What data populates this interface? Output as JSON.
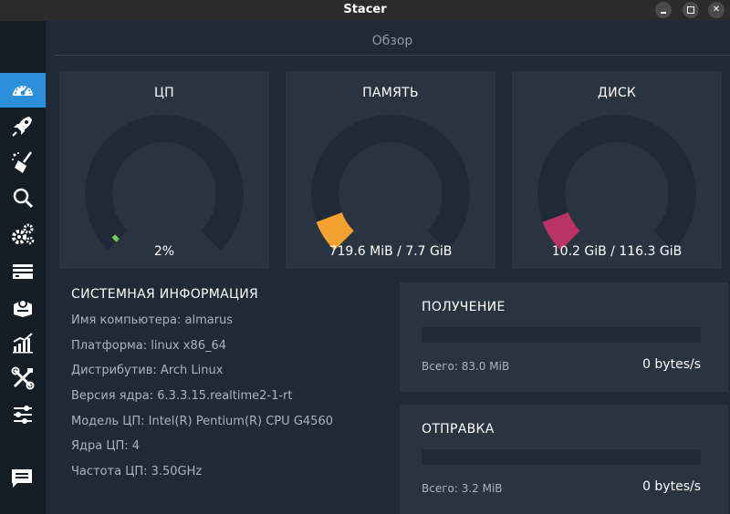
{
  "window": {
    "title": "Stacer"
  },
  "sidebar": {
    "items": [
      {
        "name": "dashboard",
        "icon": "speedometer-icon",
        "active": true
      },
      {
        "name": "startup-apps",
        "icon": "rocket-icon"
      },
      {
        "name": "system-cleaner",
        "icon": "broom-icon"
      },
      {
        "name": "search",
        "icon": "magnifier-icon"
      },
      {
        "name": "services",
        "icon": "gears-icon"
      },
      {
        "name": "processes",
        "icon": "stack-icon"
      },
      {
        "name": "uninstaller",
        "icon": "package-icon"
      },
      {
        "name": "resources",
        "icon": "bar-chart-icon"
      },
      {
        "name": "helpers",
        "icon": "tools-icon"
      },
      {
        "name": "settings",
        "icon": "sliders-icon"
      }
    ],
    "feedback_icon": "chat-icon"
  },
  "tab": {
    "label": "Обзор"
  },
  "gauges": {
    "cpu": {
      "title": "ЦП",
      "value": "2%",
      "percent": 2,
      "color": "#7ac74f"
    },
    "memory": {
      "title": "ПАМЯТЬ",
      "value": "719.6 MiB / 7.7 GiB",
      "percent": 9,
      "color": "#f4a12f"
    },
    "disk": {
      "title": "ДИСК",
      "value": "10.2 GiB / 116.3 GiB",
      "percent": 9,
      "color": "#b93366"
    }
  },
  "sysinfo": {
    "heading": "СИСТЕМНАЯ ИНФОРМАЦИЯ",
    "rows": [
      "Имя компьютера: almarus",
      "Платформа: linux x86_64",
      "Дистрибутив: Arch Linux",
      "Версия ядра: 6.3.3.15.realtime2-1-rt",
      "Модель ЦП: Intel(R) Pentium(R) CPU G4560",
      "Ядра ЦП: 4",
      "Частота ЦП: 3.50GHz"
    ]
  },
  "network": {
    "download": {
      "title": "ПОЛУЧЕНИЕ",
      "total": "Всего: 83.0 MiB",
      "rate": "0 bytes/s"
    },
    "upload": {
      "title": "ОТПРАВКА",
      "total": "Всего: 3.2 MiB",
      "rate": "0 bytes/s"
    }
  },
  "colors": {
    "accent": "#2c8fd9",
    "track": "#1f2a36",
    "card": "#2a3441"
  }
}
